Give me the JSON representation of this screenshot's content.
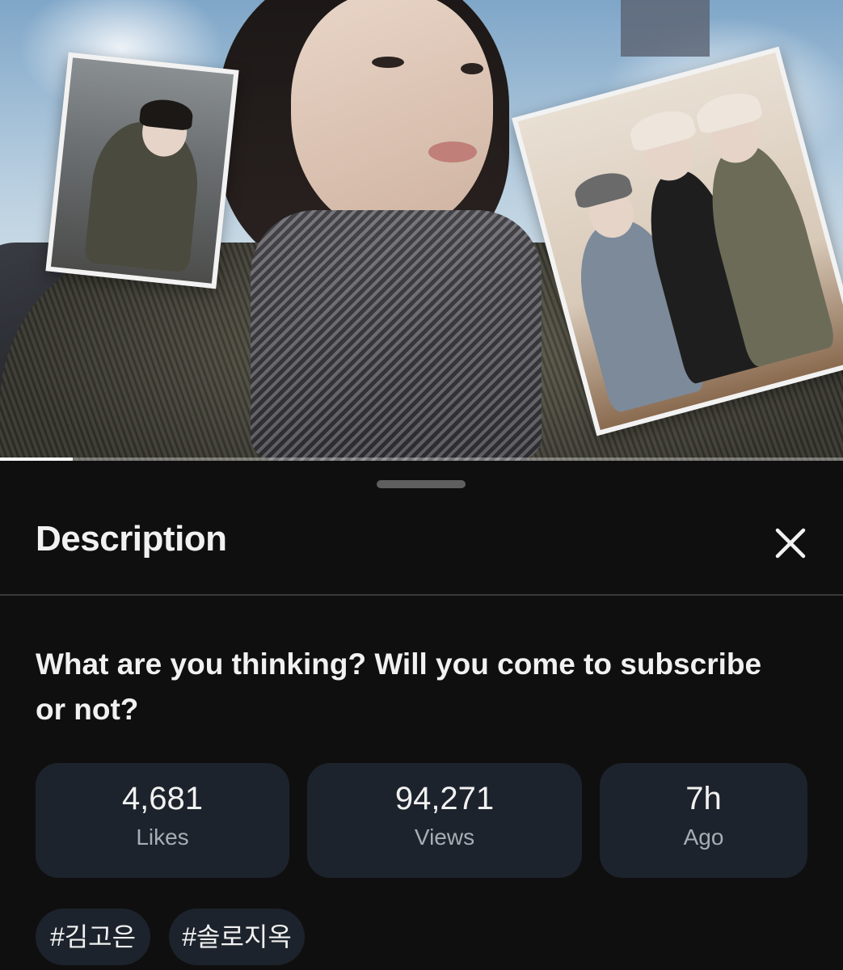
{
  "video": {
    "progress_fraction": 0.086
  },
  "description_sheet": {
    "title": "Description",
    "close_icon": "close-icon",
    "video_title": "What are you thinking? Will you come to subscribe or not?",
    "stats": [
      {
        "value": "4,681",
        "label": "Likes"
      },
      {
        "value": "94,271",
        "label": "Views"
      },
      {
        "value": "7h",
        "label": "Ago"
      }
    ],
    "hashtags": [
      "#김고은",
      "#솔로지옥"
    ]
  },
  "colors": {
    "background": "#0f0f0f",
    "card": "#1d232c",
    "text_primary": "#f1f1f1",
    "text_secondary": "#a8adb5"
  }
}
